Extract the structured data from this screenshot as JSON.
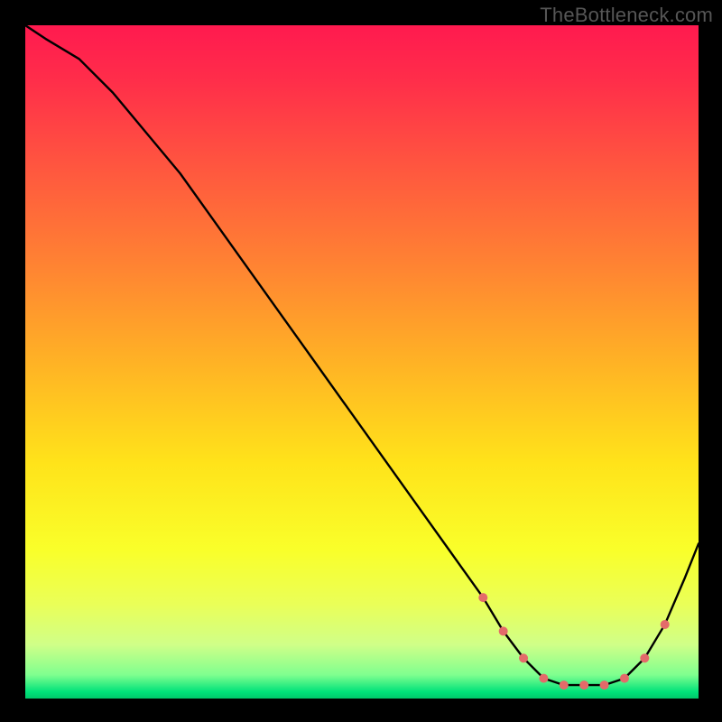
{
  "watermark": "TheBottleneck.com",
  "chart_data": {
    "type": "line",
    "title": "",
    "xlabel": "",
    "ylabel": "",
    "xlim": [
      0,
      100
    ],
    "ylim": [
      0,
      100
    ],
    "x": [
      0,
      3,
      8,
      13,
      18,
      23,
      28,
      33,
      38,
      43,
      48,
      53,
      58,
      63,
      68,
      71,
      74,
      77,
      80,
      83,
      86,
      89,
      92,
      95,
      98,
      100
    ],
    "values": [
      100,
      98,
      95,
      90,
      84,
      78,
      71,
      64,
      57,
      50,
      43,
      36,
      29,
      22,
      15,
      10,
      6,
      3,
      2,
      2,
      2,
      3,
      6,
      11,
      18,
      23
    ],
    "marker_indices": [
      14,
      15,
      16,
      17,
      18,
      19,
      20,
      21,
      22,
      23
    ],
    "background_gradient_stops": [
      {
        "offset": 0.0,
        "color": "#ff1a4f"
      },
      {
        "offset": 0.08,
        "color": "#ff2d4a"
      },
      {
        "offset": 0.2,
        "color": "#ff5340"
      },
      {
        "offset": 0.35,
        "color": "#ff8133"
      },
      {
        "offset": 0.5,
        "color": "#ffb225"
      },
      {
        "offset": 0.65,
        "color": "#ffe31a"
      },
      {
        "offset": 0.78,
        "color": "#f9ff2a"
      },
      {
        "offset": 0.86,
        "color": "#eaff58"
      },
      {
        "offset": 0.92,
        "color": "#d0ff88"
      },
      {
        "offset": 0.965,
        "color": "#7fff8f"
      },
      {
        "offset": 0.99,
        "color": "#00e27a"
      },
      {
        "offset": 1.0,
        "color": "#00c86a"
      }
    ],
    "style": {
      "curve_color": "#000000",
      "curve_width": 2.4,
      "marker_color": "#e46a6a",
      "marker_radius_px": 5
    }
  }
}
